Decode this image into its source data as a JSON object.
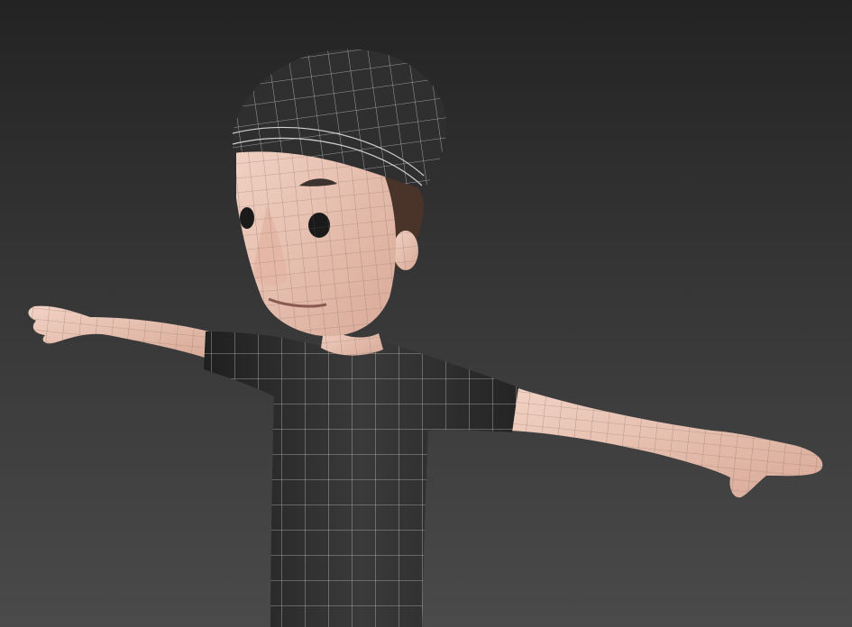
{
  "viewport": {
    "background_top": "#232323",
    "background_bottom": "#4a4a4a"
  },
  "model": {
    "skin_color": "#e9c3b4",
    "shirt_color": "#2d2d2d",
    "hat_color": "#2f2f2f",
    "hair_color": "#4a3328",
    "wire_color_on_dark": "#bdbdbd",
    "wire_color_on_skin": "#8f7a74"
  }
}
